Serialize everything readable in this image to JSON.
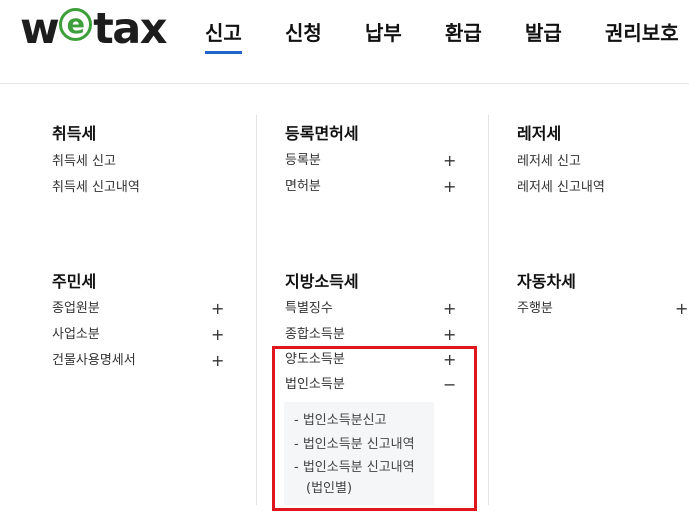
{
  "header": {
    "logo": {
      "before": "w",
      "circle": "e",
      "after": "tax"
    },
    "nav": [
      "신고",
      "신청",
      "납부",
      "환급",
      "발급",
      "권리보호"
    ],
    "active_nav": "신고"
  },
  "menu": {
    "acquisition": {
      "title": "취득세",
      "items": [
        "취득세 신고",
        "취득세 신고내역"
      ]
    },
    "registration": {
      "title": "등록면허세",
      "items": [
        "등록분",
        "면허분"
      ],
      "toggle": "+"
    },
    "leisure": {
      "title": "레저세",
      "items": [
        "레저세 신고",
        "레저세 신고내역"
      ]
    },
    "resident": {
      "title": "주민세",
      "items": [
        "종업원분",
        "사업소분",
        "건물사용명세서"
      ],
      "toggle": "+"
    },
    "local_income": {
      "title": "지방소득세",
      "items": [
        "특별징수",
        "종합소득분",
        "양도소득분",
        "법인소득분"
      ],
      "toggles": [
        "+",
        "+",
        "+",
        "−"
      ],
      "sub_items": [
        "- 법인소득분신고",
        "- 법인소득분 신고내역",
        "- 법인소득분 신고내역",
        "(법인별)"
      ]
    },
    "automobile": {
      "title": "자동차세",
      "items": [
        "주행분"
      ],
      "toggle": "+"
    }
  },
  "colors": {
    "accent": "#1f64c8",
    "highlight": "#e0161d",
    "logo_green": "#3d9f3a"
  }
}
